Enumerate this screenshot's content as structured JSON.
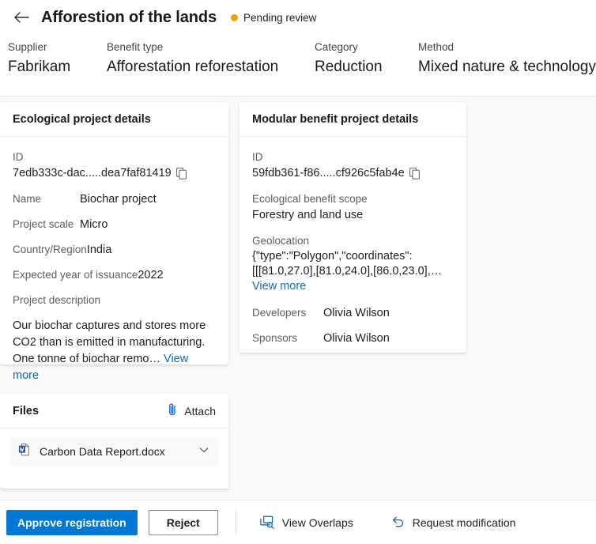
{
  "header": {
    "back_icon": "arrow-left-icon",
    "title": "Afforestion of the lands",
    "status": {
      "text": "Pending review",
      "color": "#eaa300"
    },
    "meta": [
      {
        "label": "Supplier",
        "value": "Fabrikam"
      },
      {
        "label": "Benefit type",
        "value": "Afforestation reforestation"
      },
      {
        "label": "Category",
        "value": "Reduction"
      },
      {
        "label": "Method",
        "value": "Mixed nature & technology"
      }
    ]
  },
  "ecological_card": {
    "title": "Ecological project details",
    "id_label": "ID",
    "id_value": "7edb333c-dac.....dea7faf81419",
    "copy_icon": "copy-icon",
    "fields": [
      {
        "label": "Name",
        "value": "Biochar project"
      },
      {
        "label": "Project scale",
        "value": "Micro"
      },
      {
        "label": "Country/Region",
        "value": "India"
      },
      {
        "label": "Expected year of issuance",
        "value": "2022"
      }
    ],
    "description_label": "Project description",
    "description_text": "Our biochar captures and stores more CO2 than is emitted in manufacturing. One tonne of biochar remo…",
    "view_more": "View more"
  },
  "modular_card": {
    "title": "Modular benefit project details",
    "id_label": "ID",
    "id_value": "59fdb361-f86.....cf926c5fab4e",
    "copy_icon": "copy-icon",
    "scope_label": "Ecological benefit scope",
    "scope_value": "Forestry and land use",
    "geolocation_label": "Geolocation",
    "geolocation_line1": "{\"type\":\"Polygon\",\"coordinates\":",
    "geolocation_line2": "[[[81.0,27.0],[81.0,24.0],[86.0,23.0],…",
    "view_more": "View more",
    "fields": [
      {
        "label": "Developers",
        "value": "Olivia Wilson"
      },
      {
        "label": "Sponsors",
        "value": "Olivia Wilson"
      }
    ]
  },
  "files_card": {
    "title": "Files",
    "attach_label": "Attach",
    "attach_icon": "paperclip-icon",
    "items": [
      {
        "icon": "word-document-icon",
        "name": "Carbon Data Report.docx",
        "chevron": "chevron-down-icon"
      }
    ]
  },
  "footer": {
    "approve_label": "Approve registration",
    "reject_label": "Reject",
    "view_overlaps_label": "View Overlaps",
    "view_overlaps_icon": "overlap-search-icon",
    "request_modification_label": "Request modification",
    "request_modification_icon": "undo-arrow-icon"
  },
  "colors": {
    "accent": "#0078d4",
    "link": "#0f6cbd",
    "pending": "#eaa300",
    "page_bg": "#faf9f8"
  }
}
